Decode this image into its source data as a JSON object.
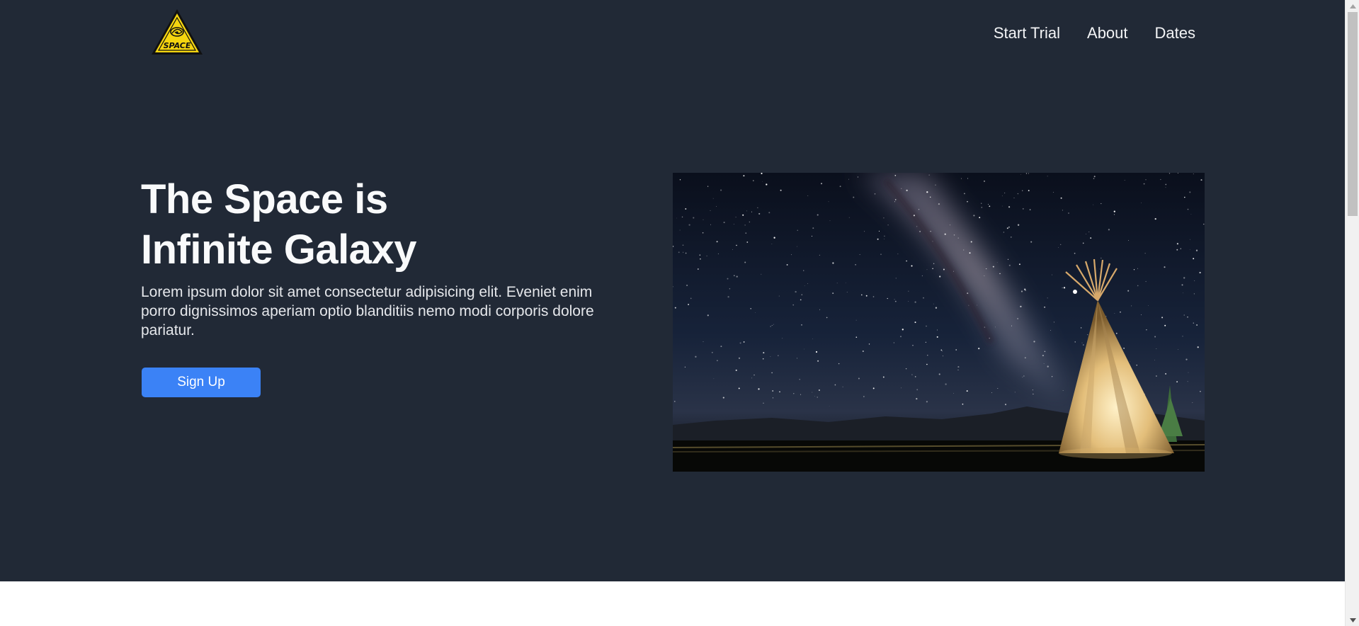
{
  "header": {
    "logo": {
      "text": "SPACE",
      "icon": "space-logo-icon",
      "colors": {
        "triangle": "#f5d50f",
        "outline": "#111111"
      }
    },
    "nav": [
      {
        "label": "Start Trial"
      },
      {
        "label": "About"
      },
      {
        "label": "Dates"
      }
    ]
  },
  "hero": {
    "title_line1": "The Space is",
    "title_line2": "Infinite Galaxy",
    "description": "Lorem ipsum dolor sit amet consectetur adipisicing elit. Eveniet enim porro dignissimos aperiam optio blanditiis nemo modi corporis dolore pariatur.",
    "signup_label": "Sign Up",
    "image": "night-sky-milky-way-teepee-image"
  },
  "theme": {
    "hero_background": "#212936",
    "accent": "#3b82f6",
    "text_primary": "#f9fafb"
  }
}
